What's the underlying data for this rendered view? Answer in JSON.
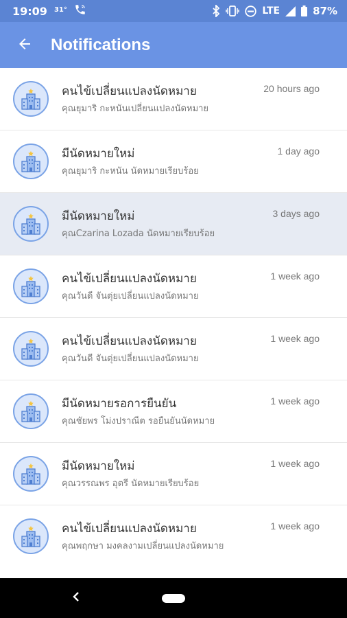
{
  "status_bar": {
    "time": "19:09",
    "temperature": "31°",
    "network": "LTE",
    "battery": "87%"
  },
  "header": {
    "title": "Notifications",
    "back_icon": "arrow-left-icon"
  },
  "notifications": [
    {
      "title": "คนไข้เปลี่ยนแปลงนัดหมาย",
      "body": "คุณยุมาริ กะหนันเปลี่ยนแปลงนัดหมาย",
      "time": "20 hours ago",
      "icon": "hospital-building-icon"
    },
    {
      "title": "มีนัดหมายใหม่",
      "body": "คุณยุมาริ กะหนัน นัดหมายเรียบร้อย",
      "time": "1 day ago",
      "icon": "hospital-building-icon"
    },
    {
      "title": "มีนัดหมายใหม่",
      "body": "คุณCzarina Lozada นัดหมายเรียบร้อย",
      "time": "3 days ago",
      "icon": "hospital-building-icon",
      "highlighted": true
    },
    {
      "title": "คนไข้เปลี่ยนแปลงนัดหมาย",
      "body": "คุณวันดี จันตุ่ยเปลี่ยนแปลงนัดหมาย",
      "time": "1 week ago",
      "icon": "hospital-building-icon"
    },
    {
      "title": "คนไข้เปลี่ยนแปลงนัดหมาย",
      "body": "คุณวันดี จันตุ่ยเปลี่ยนแปลงนัดหมาย",
      "time": "1 week ago",
      "icon": "hospital-building-icon"
    },
    {
      "title": "มีนัดหมายรอการยืนยัน",
      "body": "คุณชัยพร โม่งปราณีต รอยืนยันนัดหมาย",
      "time": "1 week ago",
      "icon": "hospital-building-icon"
    },
    {
      "title": "มีนัดหมายใหม่",
      "body": "คุณวรรณพร อุตรี นัดหมายเรียบร้อย",
      "time": "1 week ago",
      "icon": "hospital-building-icon"
    },
    {
      "title": "คนไข้เปลี่ยนแปลงนัดหมาย",
      "body": "คุณพฤกษา มงคลงามเปลี่ยนแปลงนัดหมาย",
      "time": "1 week ago",
      "icon": "hospital-building-icon"
    }
  ],
  "colors": {
    "status_bar": "#5b84d3",
    "app_bar": "#6a93e4",
    "highlight_row": "#e7ebf3",
    "avatar_fill": "#dbe7fb",
    "avatar_border": "#7aa3e6"
  }
}
